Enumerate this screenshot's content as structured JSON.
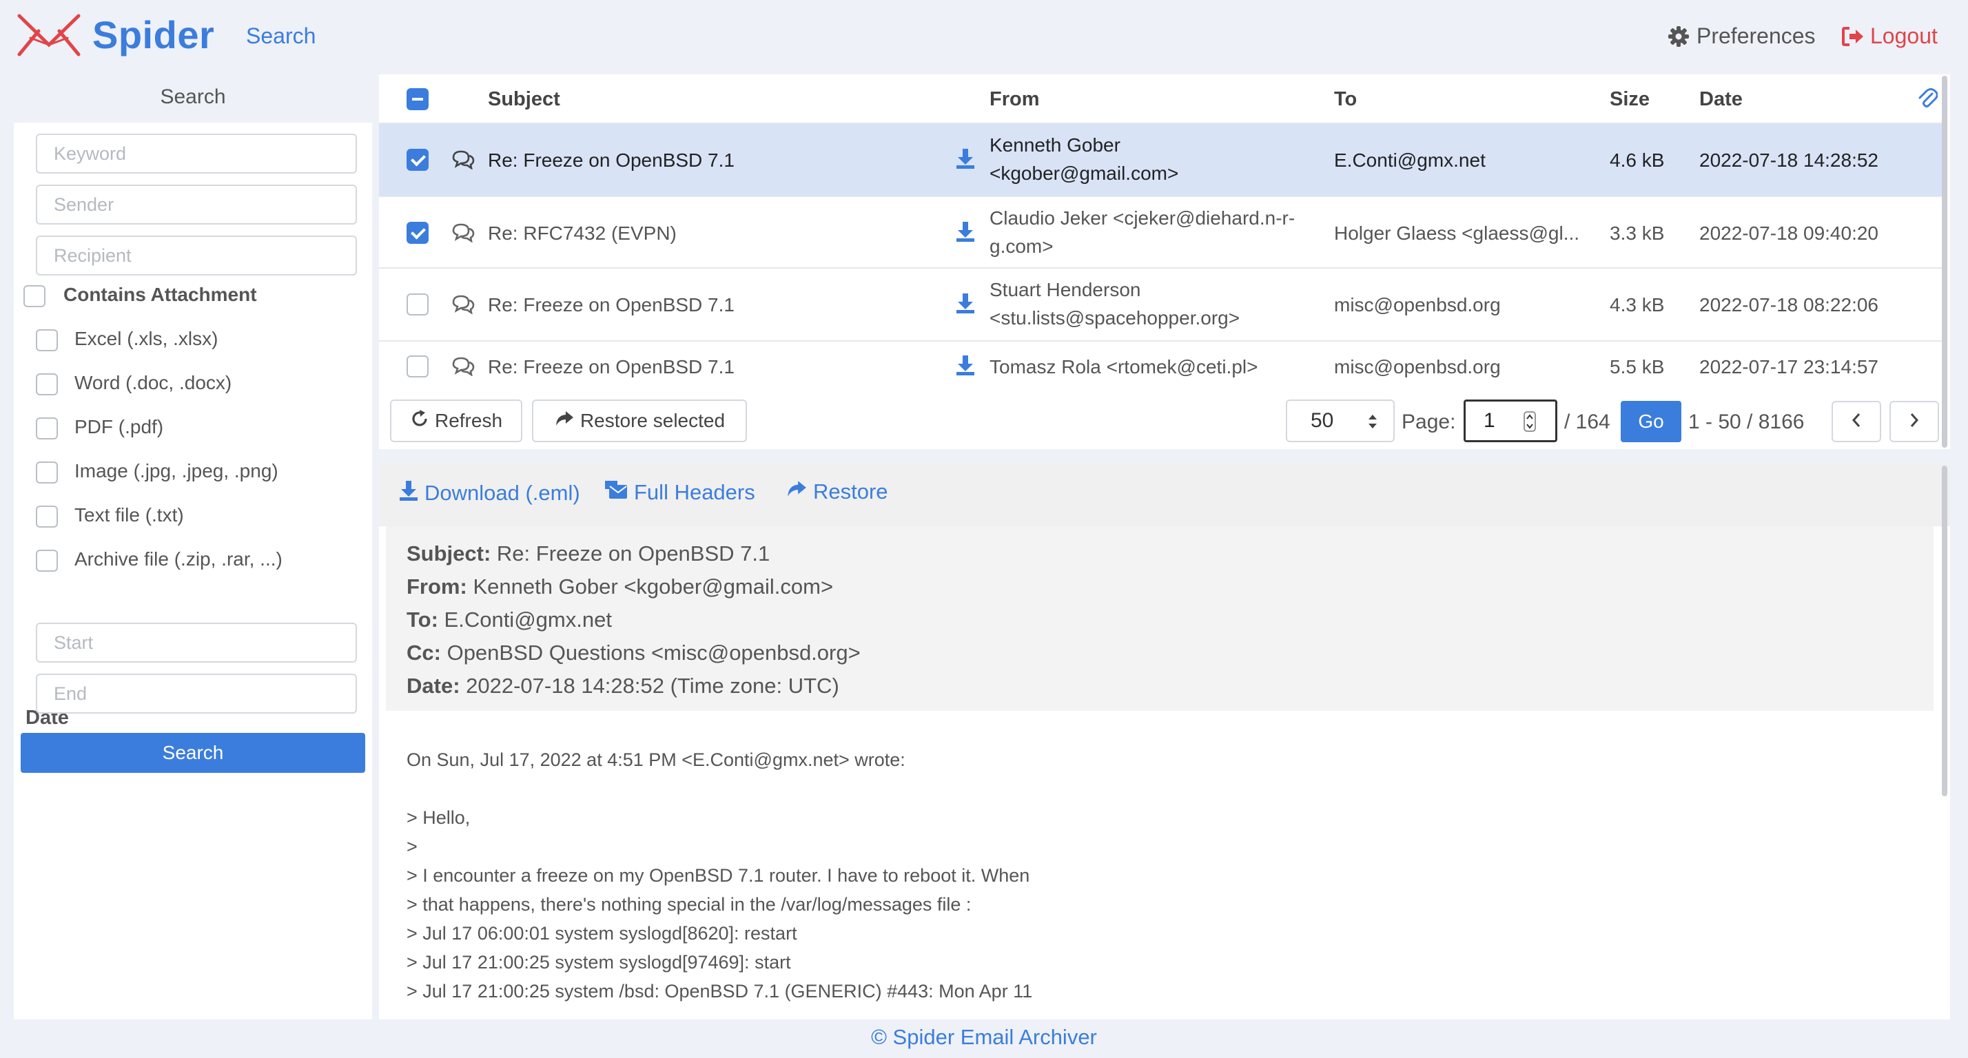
{
  "header": {
    "app_name": "Spider",
    "nav_search": "Search",
    "preferences": "Preferences",
    "logout": "Logout",
    "brand_color": "#3b7ddd",
    "logout_color": "#e0454a"
  },
  "sidebar": {
    "title": "Search",
    "keyword_placeholder": "Keyword",
    "sender_placeholder": "Sender",
    "recipient_placeholder": "Recipient",
    "contains_attachment": "Contains Attachment",
    "types": [
      "Excel (.xls, .xlsx)",
      "Word (.doc, .docx)",
      "PDF (.pdf)",
      "Image (.jpg, .jpeg, .png)",
      "Text file (.txt)",
      "Archive file (.zip, .rar, ...)"
    ],
    "date_label": "Date",
    "start_placeholder": "Start",
    "end_placeholder": "End",
    "search_button": "Search"
  },
  "list": {
    "columns": {
      "subject": "Subject",
      "from": "From",
      "to": "To",
      "size": "Size",
      "date": "Date"
    },
    "rows": [
      {
        "subject": "Re: Freeze on OpenBSD 7.1",
        "from_line1": "Kenneth Gober",
        "from_line2": "<kgober@gmail.com>",
        "to": "E.Conti@gmx.net",
        "size": "4.6 kB",
        "date": "2022-07-18 14:28:52",
        "checked": true,
        "selected": true
      },
      {
        "subject": "Re: RFC7432 (EVPN)",
        "from_line1": "Claudio Jeker <cjeker@diehard.n-r-",
        "from_line2": "g.com>",
        "to": "Holger Glaess <glaess@gl...",
        "size": "3.3 kB",
        "date": "2022-07-18 09:40:20",
        "checked": true,
        "selected": false
      },
      {
        "subject": "Re: Freeze on OpenBSD 7.1",
        "from_line1": "Stuart Henderson",
        "from_line2": "<stu.lists@spacehopper.org>",
        "to": "misc@openbsd.org",
        "size": "4.3 kB",
        "date": "2022-07-18 08:22:06",
        "checked": false,
        "selected": false
      },
      {
        "subject": "Re: Freeze on OpenBSD 7.1",
        "from_line1": "Tomasz Rola <rtomek@ceti.pl>",
        "from_line2": "",
        "to": "misc@openbsd.org",
        "size": "5.5 kB",
        "date": "2022-07-17 23:14:57",
        "checked": false,
        "selected": false
      }
    ],
    "refresh": "Refresh",
    "restore_selected": "Restore selected",
    "per_page": "50",
    "page_label": "Page:",
    "page_value": "1",
    "page_total": "/ 164",
    "go": "Go",
    "range": "1 - 50 / 8166"
  },
  "detail": {
    "download": "Download (.eml)",
    "full_headers": "Full Headers",
    "restore": "Restore",
    "subject_label": "Subject:",
    "subject": "Re: Freeze on OpenBSD 7.1",
    "from_label": "From:",
    "from": "Kenneth Gober <kgober@gmail.com>",
    "to_label": "To:",
    "to": "E.Conti@gmx.net",
    "cc_label": "Cc:",
    "cc": "OpenBSD Questions <misc@openbsd.org>",
    "date_label": "Date:",
    "date": "2022-07-18 14:28:52 (Time zone: UTC)",
    "body": "On Sun, Jul 17, 2022 at 4:51 PM <E.Conti@gmx.net> wrote:\n\n> Hello,\n>\n> I encounter a freeze on my OpenBSD 7.1 router. I have to reboot it. When\n> that happens, there's nothing special in the /var/log/messages file :\n> Jul 17 06:00:01 system syslogd[8620]: restart\n> Jul 17 21:00:25 system syslogd[97469]: start\n> Jul 17 21:00:25 system /bsd: OpenBSD 7.1 (GENERIC) #443: Mon Apr 11"
  },
  "footer": {
    "text": "© Spider Email Archiver"
  }
}
